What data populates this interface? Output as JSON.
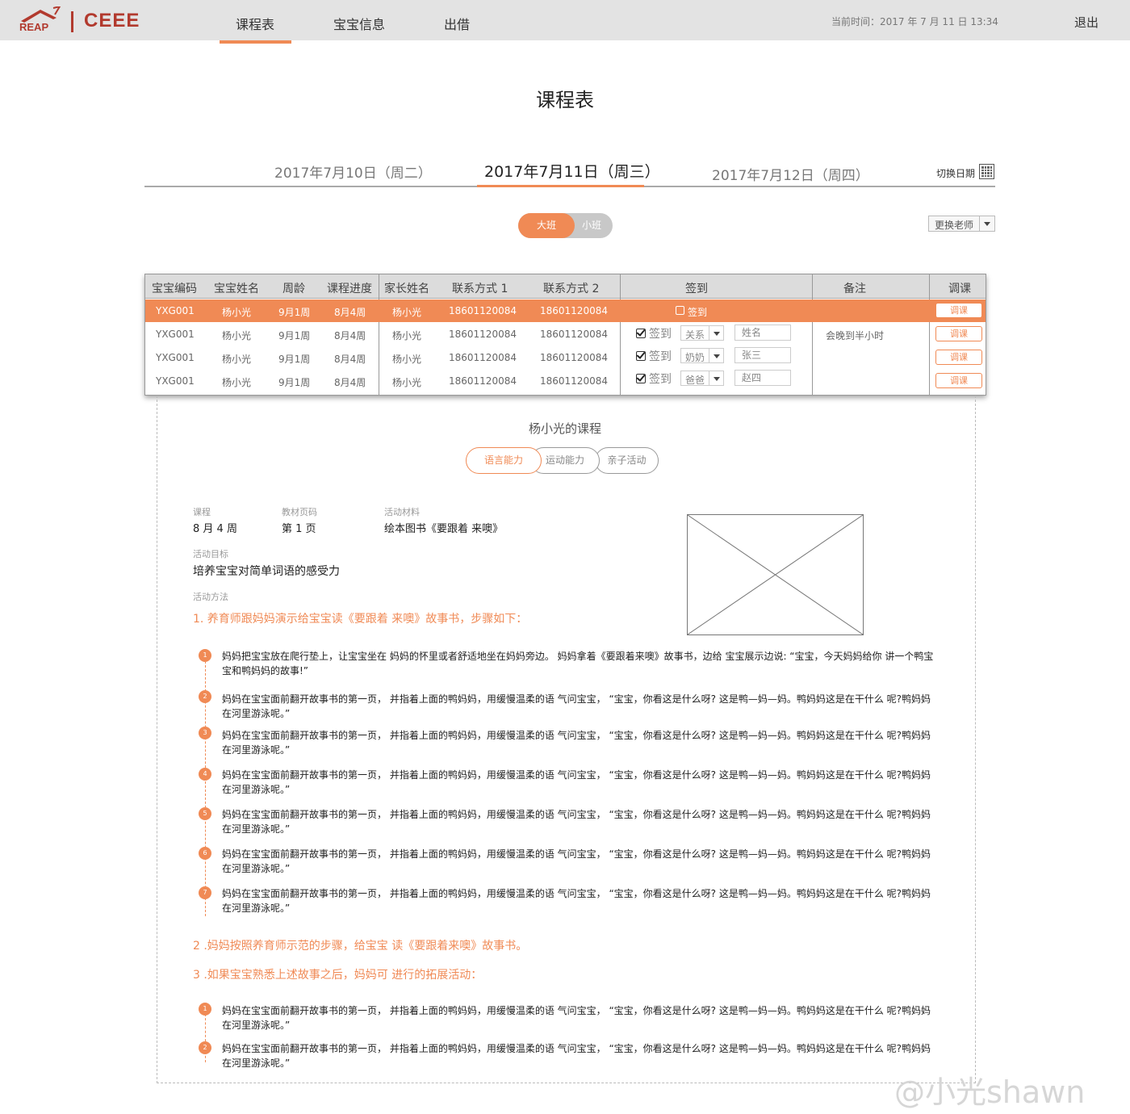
{
  "header": {
    "logo_text": "CEEE",
    "logo_mark_text": "REAP",
    "nav": [
      "课程表",
      "宝宝信息",
      "出借"
    ],
    "current_time": "当前时间：2017 年 7 月 11 日 13:34",
    "logout": "退出"
  },
  "page_title": "课程表",
  "dates": {
    "prev": "2017年7月10日（周二）",
    "current": "2017年7月11日（周三）",
    "next": "2017年7月12日（周四）",
    "switch_label": "切换日期"
  },
  "class_toggle": {
    "big": "大班",
    "small": "小班",
    "selected": "大班"
  },
  "teacher_select": "更换老师",
  "table": {
    "headers": [
      "宝宝编码",
      "宝宝姓名",
      "周龄",
      "课程进度",
      "家长姓名",
      "联系方式 1",
      "联系方式 2",
      "签到",
      "备注",
      "调课"
    ],
    "rows": [
      {
        "code": "YXG001",
        "name": "杨小光",
        "age": "9月1周",
        "progress": "8月4周",
        "parent": "杨小光",
        "phone1": "18601120084",
        "phone2": "18601120084",
        "sign": "签到",
        "checked": false,
        "relation": "",
        "sign_name": "",
        "note": "",
        "adjust": "调课"
      },
      {
        "code": "YXG001",
        "name": "杨小光",
        "age": "9月1周",
        "progress": "8月4周",
        "parent": "杨小光",
        "phone1": "18601120084",
        "phone2": "18601120084",
        "sign": "签到",
        "checked": true,
        "relation": "关系",
        "sign_name": "姓名",
        "note": "会晚到半小时",
        "adjust": "调课"
      },
      {
        "code": "YXG001",
        "name": "杨小光",
        "age": "9月1周",
        "progress": "8月4周",
        "parent": "杨小光",
        "phone1": "18601120084",
        "phone2": "18601120084",
        "sign": "签到",
        "checked": true,
        "relation": "奶奶",
        "sign_name": "张三",
        "note": "",
        "adjust": "调课"
      },
      {
        "code": "YXG001",
        "name": "杨小光",
        "age": "9月1周",
        "progress": "8月4周",
        "parent": "杨小光",
        "phone1": "18601120084",
        "phone2": "18601120084",
        "sign": "签到",
        "checked": true,
        "relation": "爸爸",
        "sign_name": "赵四",
        "note": "",
        "adjust": "调课"
      }
    ]
  },
  "detail": {
    "title": "杨小光的课程",
    "tabs": [
      "语言能力",
      "运动能力",
      "亲子活动"
    ],
    "active_tab": "语言能力",
    "course_label": "课程",
    "course_value": "8 月 4 周",
    "page_label": "教材页码",
    "page_value": "第 1 页",
    "material_label": "活动材料",
    "material_value": "绘本图书《要跟着 来噢》",
    "goal_label": "活动目标",
    "goal_value": "培养宝宝对简单词语的感受力",
    "method_label": "活动方法",
    "step1_head": "1. 养育师跟妈妈演示给宝宝读《要跟着 来噢》故事书，步骤如下：",
    "steps1": [
      {
        "n": "1",
        "text": "妈妈把宝宝放在爬行垫上，让宝宝坐在 妈妈的怀里或者舒适地坐在妈妈旁边。 妈妈拿着《要跟着来噢》故事书，边给 宝宝展示边说: “宝宝，今天妈妈给你 讲一个鸭宝宝和鸭妈妈的故事!”"
      },
      {
        "n": "2",
        "text": "妈妈在宝宝面前翻开故事书的第一页， 并指着上面的鸭妈妈，用缓慢温柔的语 气问宝宝， “宝宝，你看这是什么呀? 这是鸭—妈—妈。鸭妈妈这是在干什么 呢?鸭妈妈在河里游泳呢。”"
      },
      {
        "n": "3",
        "text": "妈妈在宝宝面前翻开故事书的第一页， 并指着上面的鸭妈妈，用缓慢温柔的语 气问宝宝， “宝宝，你看这是什么呀? 这是鸭—妈—妈。鸭妈妈这是在干什么 呢?鸭妈妈在河里游泳呢。”"
      },
      {
        "n": "4",
        "text": "妈妈在宝宝面前翻开故事书的第一页， 并指着上面的鸭妈妈，用缓慢温柔的语 气问宝宝， “宝宝，你看这是什么呀? 这是鸭—妈—妈。鸭妈妈这是在干什么 呢?鸭妈妈在河里游泳呢。”"
      },
      {
        "n": "5",
        "text": "妈妈在宝宝面前翻开故事书的第一页， 并指着上面的鸭妈妈，用缓慢温柔的语 气问宝宝， “宝宝，你看这是什么呀? 这是鸭—妈—妈。鸭妈妈这是在干什么 呢?鸭妈妈在河里游泳呢。”"
      },
      {
        "n": "6",
        "text": "妈妈在宝宝面前翻开故事书的第一页， 并指着上面的鸭妈妈，用缓慢温柔的语 气问宝宝， “宝宝，你看这是什么呀? 这是鸭—妈—妈。鸭妈妈这是在干什么 呢?鸭妈妈在河里游泳呢。”"
      },
      {
        "n": "7",
        "text": "妈妈在宝宝面前翻开故事书的第一页， 并指着上面的鸭妈妈，用缓慢温柔的语 气问宝宝， “宝宝，你看这是什么呀? 这是鸭—妈—妈。鸭妈妈这是在干什么 呢?鸭妈妈在河里游泳呢。”"
      }
    ],
    "step2_head": "2 .妈妈按照养育师示范的步骤，给宝宝 读《要跟着来噢》故事书。",
    "step3_head": "3 .如果宝宝熟悉上述故事之后，妈妈可 进行的拓展活动：",
    "steps3": [
      {
        "n": "1",
        "text": "妈妈在宝宝面前翻开故事书的第一页， 并指着上面的鸭妈妈，用缓慢温柔的语 气问宝宝， “宝宝，你看这是什么呀? 这是鸭—妈—妈。鸭妈妈这是在干什么 呢?鸭妈妈在河里游泳呢。”"
      },
      {
        "n": "2",
        "text": "妈妈在宝宝面前翻开故事书的第一页， 并指着上面的鸭妈妈，用缓慢温柔的语 气问宝宝， “宝宝，你看这是什么呀? 这是鸭—妈—妈。鸭妈妈这是在干什么 呢?鸭妈妈在河里游泳呢。”"
      }
    ]
  },
  "watermark": "@小光shawn",
  "colors": {
    "accent": "#f08a55",
    "brand": "#b23a2e",
    "topbar": "#e3e3e3"
  }
}
